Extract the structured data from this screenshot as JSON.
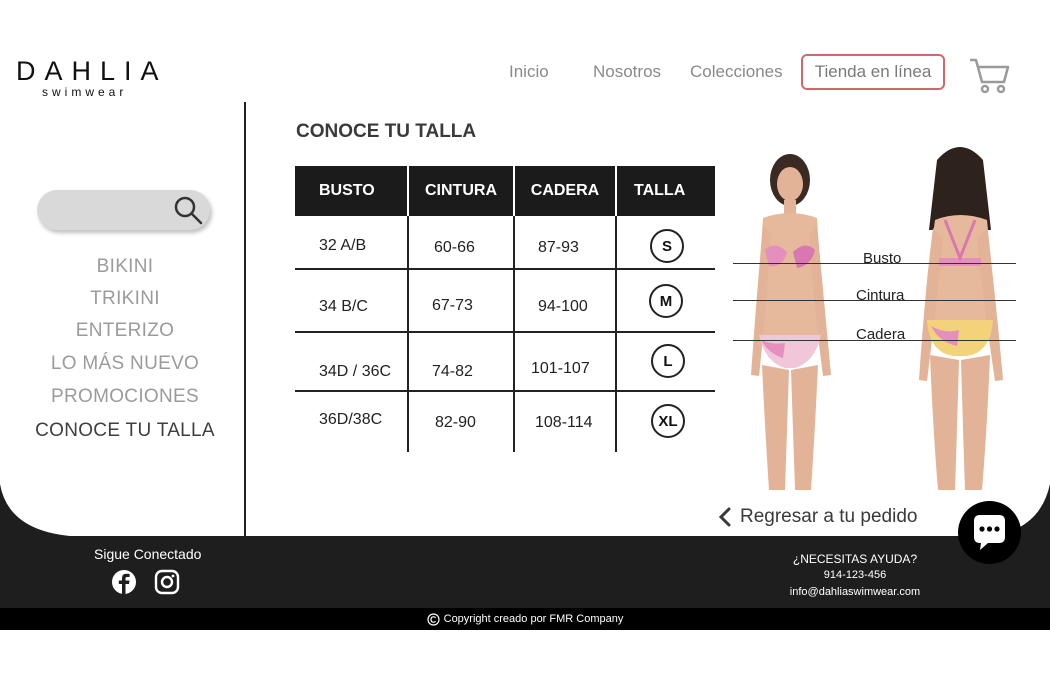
{
  "brand": {
    "name": "DAHLIA",
    "tagline": "swimwear"
  },
  "nav": {
    "items": [
      {
        "label": "Inicio"
      },
      {
        "label": "Nosotros"
      },
      {
        "label": "Colecciones"
      }
    ],
    "store_label": "Tienda en línea"
  },
  "sidebar": {
    "search_placeholder": "",
    "categories": [
      {
        "label": "BIKINI"
      },
      {
        "label": "TRIKINI"
      },
      {
        "label": "ENTERIZO"
      },
      {
        "label": "LO MÁS NUEVO"
      },
      {
        "label": "PROMOCIONES"
      },
      {
        "label": "CONOCE TU TALLA"
      }
    ]
  },
  "size_guide": {
    "title": "CONOCE TU TALLA",
    "headers": [
      "BUSTO",
      "CINTURA",
      "CADERA",
      "TALLA"
    ],
    "rows": [
      {
        "busto": "32 A/B",
        "cintura": "60-66",
        "cadera": "87-93",
        "talla": "S"
      },
      {
        "busto": "34 B/C",
        "cintura": "67-73",
        "cadera": "94-100",
        "talla": "M"
      },
      {
        "busto": "34D / 36C",
        "cintura": "74-82",
        "cadera": "101-107",
        "talla": "L"
      },
      {
        "busto": "36D/38C",
        "cintura": "82-90",
        "cadera": "108-114",
        "talla": "XL"
      }
    ],
    "measure_labels": [
      "Busto",
      "Cintura",
      "Cadera"
    ]
  },
  "back_link": "Regresar a tu pedido",
  "footer": {
    "follow": "Sigue Conectado",
    "help_title": "¿NECESITAS AYUDA?",
    "phone": "914-123-456",
    "email": "info@dahliaswimwear.com",
    "copyright": "Copyright creado por FMR Company"
  },
  "colors": {
    "accent": "#d06a6a",
    "dark": "#1b1b1b",
    "footer": "#1e1e1e"
  },
  "icons": [
    "cart-icon",
    "search-icon",
    "facebook-icon",
    "instagram-icon",
    "chevron-left-icon",
    "chat-icon",
    "copyright-icon"
  ]
}
